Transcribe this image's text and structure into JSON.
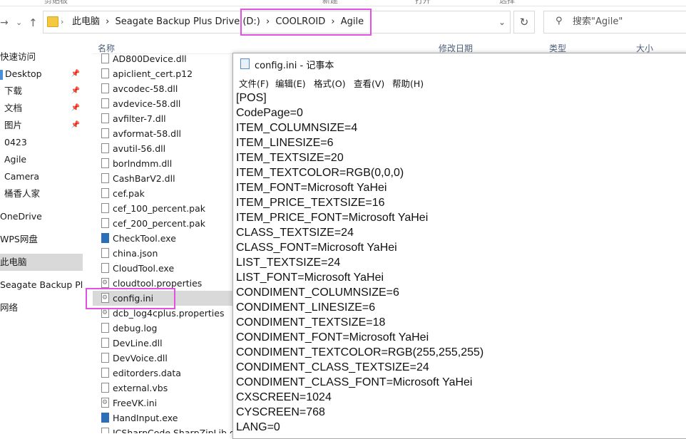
{
  "ribbon": {
    "labels": [
      "剪贴板",
      "打开",
      "新建",
      "选择"
    ]
  },
  "address": {
    "crumbs": [
      "此电脑",
      "›",
      "Seagate Backup Plus Drive (D:)",
      "›",
      "COOLROID",
      "›",
      "Agile"
    ],
    "search_placeholder": "搜索\"Agile\""
  },
  "columns": {
    "name": "名称",
    "modified": "修改日期",
    "type": "类型",
    "size": "大小"
  },
  "nav": [
    {
      "label": "快速访问",
      "pinned": false
    },
    {
      "label": "Desktop",
      "pinned": true
    },
    {
      "label": "下载",
      "pinned": true
    },
    {
      "label": "文档",
      "pinned": true
    },
    {
      "label": "图片",
      "pinned": true
    },
    {
      "label": "0423",
      "pinned": false
    },
    {
      "label": "Agile",
      "pinned": false
    },
    {
      "label": "Camera",
      "pinned": false
    },
    {
      "label": "桶香人家",
      "pinned": false
    },
    {
      "label": "OneDrive",
      "pinned": false
    },
    {
      "label": "WPS网盘",
      "pinned": false
    },
    {
      "label": "此电脑",
      "pinned": false
    },
    {
      "label": "Seagate Backup Plus",
      "pinned": false
    },
    {
      "label": "网络",
      "pinned": false
    }
  ],
  "files": [
    "AD800Device.dll",
    "apiclient_cert.p12",
    "avcodec-58.dll",
    "avdevice-58.dll",
    "avfilter-7.dll",
    "avformat-58.dll",
    "avutil-56.dll",
    "borlndmm.dll",
    "CashBarV2.dll",
    "cef.pak",
    "cef_100_percent.pak",
    "cef_200_percent.pak",
    "CheckTool.exe",
    "china.json",
    "CloudTool.exe",
    "cloudtool.properties",
    "config.ini",
    "dcb_log4cplus.properties",
    "debug.log",
    "DevLine.dll",
    "DevVoice.dll",
    "editorders.data",
    "external.vbs",
    "FreeVK.ini",
    "HandInput.exe",
    "ICSharpCode.SharpZipLib.dll"
  ],
  "notepad": {
    "title": "config.ini - 记事本",
    "menu": [
      "文件(F)",
      "编辑(E)",
      "格式(O)",
      "查看(V)",
      "帮助(H)"
    ],
    "lines": [
      "[POS]",
      "CodePage=0",
      "ITEM_COLUMNSIZE=4",
      "ITEM_LINESIZE=6",
      "ITEM_TEXTSIZE=20",
      "ITEM_TEXTCOLOR=RGB(0,0,0)",
      "ITEM_FONT=Microsoft YaHei",
      "ITEM_PRICE_TEXTSIZE=16",
      "ITEM_PRICE_FONT=Microsoft YaHei",
      "CLASS_TEXTSIZE=24",
      "CLASS_FONT=Microsoft YaHei",
      "LIST_TEXTSIZE=24",
      "LIST_FONT=Microsoft YaHei",
      "CONDIMENT_COLUMNSIZE=6",
      "CONDIMENT_LINESIZE=6",
      "CONDIMENT_TEXTSIZE=18",
      "CONDIMENT_FONT=Microsoft YaHei",
      "CONDIMENT_TEXTCOLOR=RGB(255,255,255)",
      "CONDIMENT_CLASS_TEXTSIZE=24",
      "CONDIMENT_CLASS_FONT=Microsoft YaHei",
      "CXSCREEN=1024",
      "CYSCREEN=768",
      "LANG=0"
    ]
  },
  "selected_file": "config.ini",
  "selected_nav": "此电脑",
  "colors": {
    "highlight": "#e052e0",
    "selection": "#d9d9d9"
  }
}
